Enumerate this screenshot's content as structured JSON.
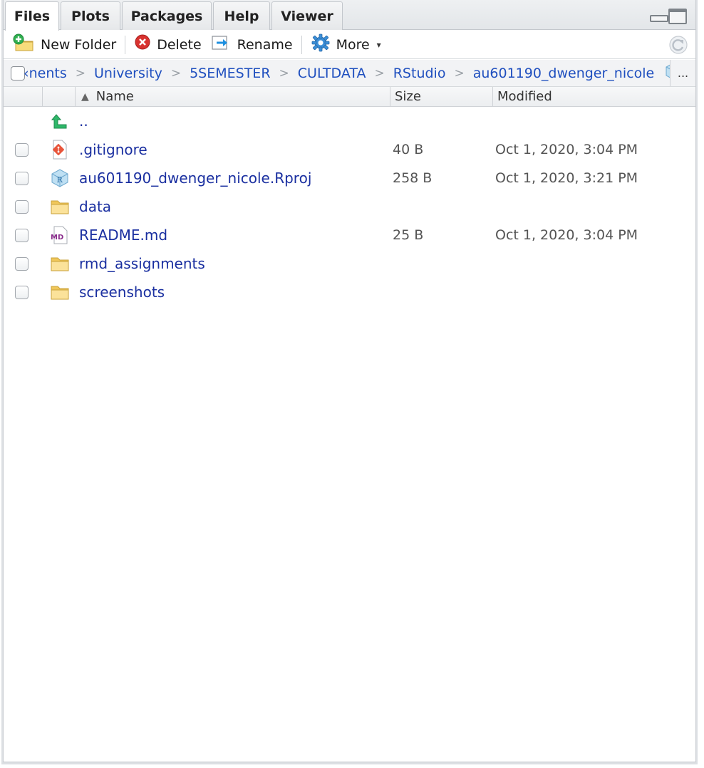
{
  "tabs": [
    {
      "label": "Files",
      "active": true
    },
    {
      "label": "Plots",
      "active": false
    },
    {
      "label": "Packages",
      "active": false
    },
    {
      "label": "Help",
      "active": false
    },
    {
      "label": "Viewer",
      "active": false
    }
  ],
  "toolbar": {
    "new_folder": "New Folder",
    "delete": "Delete",
    "rename": "Rename",
    "more": "More"
  },
  "breadcrumb": {
    "items": [
      "‹nents",
      "University",
      "5SEMESTER",
      "CULTDATA",
      "RStudio",
      "au601190_dwenger_nicole"
    ],
    "overflow": "..."
  },
  "columns": {
    "name": "Name",
    "size": "Size",
    "modified": "Modified"
  },
  "files": [
    {
      "name": "..",
      "size": "",
      "modified": "",
      "icon": "parent-dir-icon"
    },
    {
      "name": ".gitignore",
      "size": "40 B",
      "modified": "Oct 1, 2020, 3:04 PM",
      "icon": "gitignore-icon"
    },
    {
      "name": "au601190_dwenger_nicole.Rproj",
      "size": "258 B",
      "modified": "Oct 1, 2020, 3:21 PM",
      "icon": "rproj-icon"
    },
    {
      "name": "data",
      "size": "",
      "modified": "",
      "icon": "folder-icon"
    },
    {
      "name": "README.md",
      "size": "25 B",
      "modified": "Oct 1, 2020, 3:04 PM",
      "icon": "markdown-icon"
    },
    {
      "name": "rmd_assignments",
      "size": "",
      "modified": "",
      "icon": "folder-icon"
    },
    {
      "name": "screenshots",
      "size": "",
      "modified": "",
      "icon": "folder-icon"
    }
  ],
  "colors": {
    "link": "#1f4fbf",
    "file_name": "#1a2fa0"
  }
}
